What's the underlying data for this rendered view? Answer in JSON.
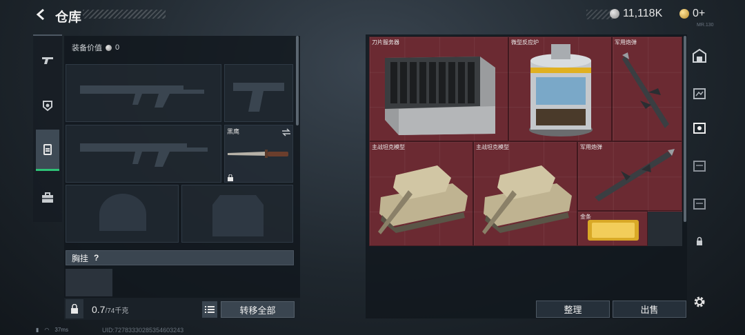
{
  "header": {
    "title": "仓库",
    "currency_silver": "11,118K",
    "currency_gold": "0+",
    "version": "MR.130"
  },
  "left": {
    "equip_label": "装备价值",
    "equip_value": "0",
    "knife_name": "黑鹰",
    "chest_label": "胸挂",
    "chest_help": "?",
    "weight_value": "0.7",
    "weight_max": "/74千克",
    "move_all": "转移全部"
  },
  "stash": {
    "items": [
      {
        "name": "刀片服务器"
      },
      {
        "name": "微型反应炉"
      },
      {
        "name": "军用炮弹"
      },
      {
        "name": "主战坦克模型"
      },
      {
        "name": "主战坦克模型"
      },
      {
        "name": "军用炮弹"
      },
      {
        "name": "金条"
      }
    ],
    "sort": "整理",
    "sell": "出售"
  },
  "status": {
    "ping": "37ms",
    "uid": "UID:72783330285354603243"
  },
  "colors": {
    "stash_bg": "#6b2a32",
    "active_tab": "#2ec276"
  }
}
